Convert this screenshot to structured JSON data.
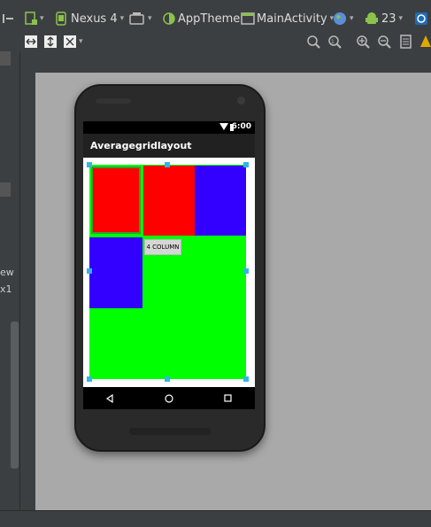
{
  "toolbar": {
    "device": "Nexus 4",
    "theme": "AppTheme",
    "activity": "MainActivity",
    "api": "23"
  },
  "left_panel": {
    "text1": "ew",
    "text2": "x1"
  },
  "app": {
    "time": "6:00",
    "title": "Averagegridlayout",
    "button_label": "4 COLUMN"
  },
  "colors": {
    "red": "#ff0000",
    "green": "#00ff00",
    "blue": "#3300ff",
    "handle": "#33b5e5"
  }
}
